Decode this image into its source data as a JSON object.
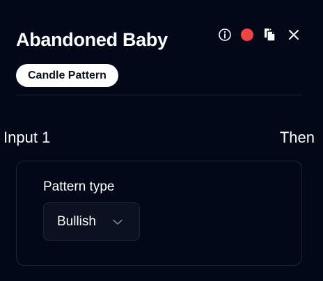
{
  "node": {
    "title": "Abandoned Baby",
    "badge": "Candle Pattern"
  },
  "toolbar": {
    "icons": [
      "info-icon",
      "status-dot",
      "copy-icon",
      "close-icon"
    ],
    "status_color": "#ef4444"
  },
  "io": {
    "input_label": "Input 1",
    "output_label": "Then"
  },
  "settings": {
    "pattern_type_label": "Pattern type",
    "pattern_type_value": "Bullish"
  },
  "colors": {
    "background": "#020817",
    "text": "#ffffff",
    "badge_bg": "#ffffff",
    "badge_text": "#0a0f1f",
    "border": "#1e2636",
    "select_bg": "#0b1120"
  }
}
